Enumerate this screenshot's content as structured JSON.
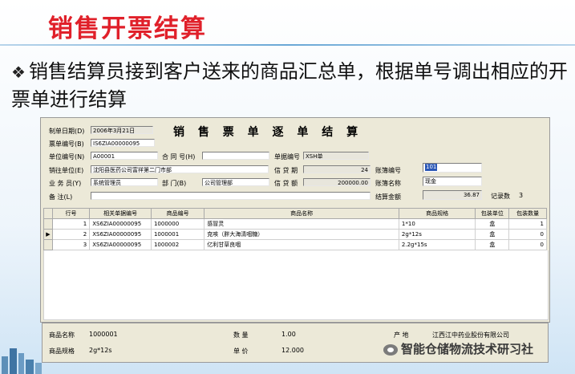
{
  "slide": {
    "title": "销售开票结算",
    "bullet": "销售结算员接到客户送来的商品汇总单，根据单号调出相应的开票单进行结算"
  },
  "form": {
    "title": "销 售 票 单 逐 单 结 算",
    "date_label": "制单日期(D)",
    "date_value": "2006年3月21日",
    "ticket_no_label": "票单编号(B)",
    "ticket_no_value": "IS6ZIA00000095",
    "unit_no_label": "单位编号(N)",
    "unit_no_value": "A00001",
    "contract_label": "合 同 号(H)",
    "contract_value": "",
    "doc_no_label": "单据编号",
    "doc_no_value": "XSH单",
    "sales_unit_label": "销往单位(E)",
    "sales_unit_value": "沈阳县医药公司富祥第二门市部",
    "credit_period_label": "信 贷 期",
    "credit_period_value": "24",
    "account_no_label": "账簿编号",
    "account_no_value": "101",
    "salesman_label": "业 务 员(Y)",
    "salesman_value": "系统管理员",
    "dept_label": "部 门(B)",
    "dept_value": "公司管理部",
    "credit_amount_label": "信 贷 额",
    "credit_amount_value": "200000.00",
    "account_name_label": "账簿名称",
    "account_name_value": "现金",
    "remark_label": "备 注(L)",
    "remark_value": "",
    "settle_amount_label": "结算金额",
    "settle_amount_value": "36.87",
    "record_count_label": "记录数",
    "record_count_value": "3"
  },
  "table": {
    "headers": [
      "行号",
      "相关单据编号",
      "商品编号",
      "商品名称",
      "商品规格",
      "包装单位",
      "包装数量"
    ],
    "rows": [
      {
        "line": "1",
        "doc": "XS6ZIA00000095",
        "code": "1000000",
        "name": "感冒灵",
        "spec": "1*10",
        "unit": "盒",
        "qty": "1"
      },
      {
        "line": "2",
        "doc": "XS6ZIA00000095",
        "code": "1000001",
        "name": "克咳（胖大海清咽糖）",
        "spec": "2g*12s",
        "unit": "盒",
        "qty": "0"
      },
      {
        "line": "3",
        "doc": "XS6ZIA00000095",
        "code": "1000002",
        "name": "亿利甘草良咽",
        "spec": "2.2g*15s",
        "unit": "盒",
        "qty": "0"
      }
    ]
  },
  "bottom": {
    "product_name_label": "商品名称",
    "product_name_value": "1000001",
    "product_spec_label": "商品规格",
    "product_spec_value": "2g*12s",
    "qty_label": "数 量",
    "qty_value": "1.00",
    "price_label": "单 价",
    "price_value": "12.000",
    "origin_label": "产 地",
    "origin_value": "江西江中药业股份有限公司"
  },
  "watermark": "智能仓储物流技术研习社",
  "colors": {
    "title_red": "#e0202a",
    "selection_blue": "#2a57b6",
    "window_gray": "#ece9d8"
  }
}
